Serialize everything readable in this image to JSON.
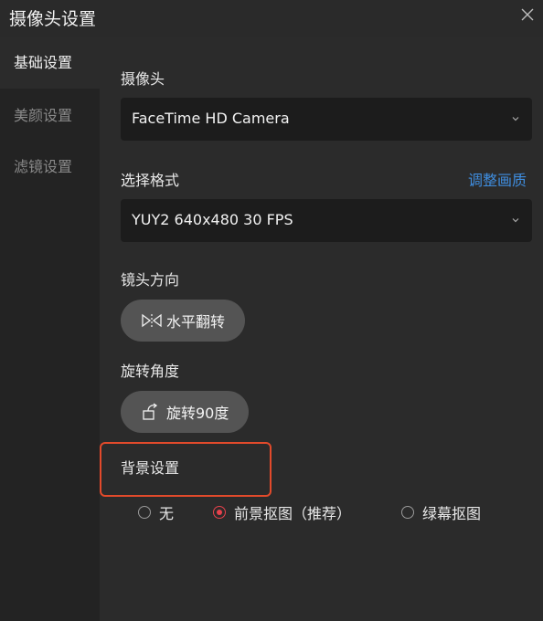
{
  "window": {
    "title": "摄像头设置",
    "close_icon": "close-icon"
  },
  "sidebar": {
    "items": [
      {
        "label": "基础设置",
        "active": true
      },
      {
        "label": "美颜设置",
        "active": false
      },
      {
        "label": "滤镜设置",
        "active": false
      }
    ]
  },
  "camera": {
    "label": "摄像头",
    "value": "FaceTime HD Camera"
  },
  "format": {
    "label": "选择格式",
    "link": "调整画质",
    "value": "YUY2 640x480 30 FPS"
  },
  "lens": {
    "label": "镜头方向",
    "button": "水平翻转",
    "icon": "flip-horizontal-icon"
  },
  "rotation": {
    "label": "旋转角度",
    "button": "旋转90度",
    "icon": "rotate-icon"
  },
  "background": {
    "label": "背景设置",
    "options": [
      {
        "label": "无",
        "checked": false
      },
      {
        "label": "前景抠图（推荐）",
        "checked": true
      },
      {
        "label": "绿幕抠图",
        "checked": false
      }
    ]
  },
  "colors": {
    "accent": "#e8424c",
    "link": "#3f8ee0",
    "highlight": "#e24a2b"
  }
}
